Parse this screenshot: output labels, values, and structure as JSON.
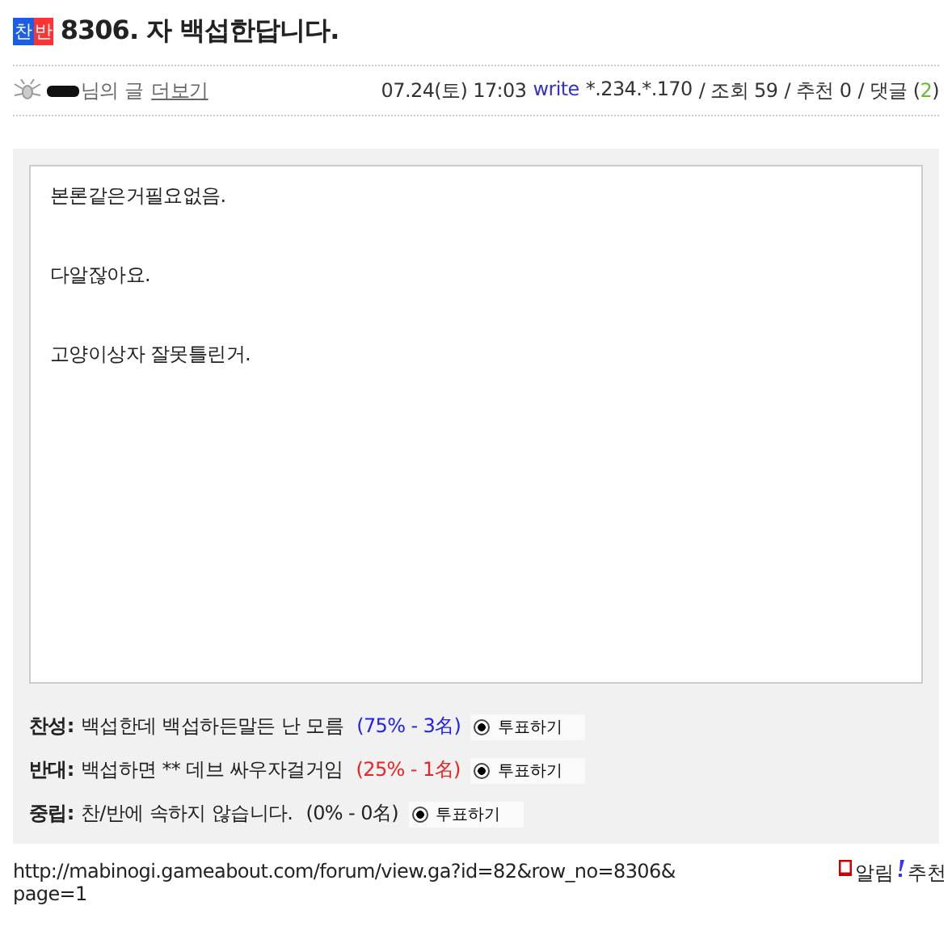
{
  "title": {
    "badge_left": "찬",
    "badge_right": "반",
    "text": "8306. 자 백섭한답니다."
  },
  "meta": {
    "suffix": "님의 글",
    "more_link": "더보기",
    "datetime": "07.24(토) 17:03",
    "write": "write",
    "ip": "*.234.*.170",
    "views": "/ 조회 59",
    "recommends": "/ 추천 0",
    "comments_label": "/ 댓글 (",
    "comments_count": "2",
    "comments_close": ")"
  },
  "body": {
    "paragraphs": [
      "본론같은거필요없음.",
      "다알잖아요.",
      "고양이상자 잘못틀린거."
    ]
  },
  "poll": [
    {
      "label": "찬성:",
      "text": "백섭한데 백섭하든말든 난 모름",
      "result": "(75% - 3名)",
      "color": "#2222ee",
      "button": "투표하기"
    },
    {
      "label": "반대:",
      "text": "백섭하면 ** 데브 싸우자걸거임",
      "result": "(25% - 1名)",
      "color": "#ee2222",
      "button": "투표하기"
    },
    {
      "label": "중립:",
      "text": "찬/반에 속하지 않습니다.",
      "result": "(0% - 0名)",
      "color": "#222222",
      "button": "투표하기"
    }
  ],
  "footer": {
    "url": "http://mabinogi.gameabout.com/forum/view.ga?id=82&row_no=8306& page=1",
    "alarm": "알림",
    "recommend": "추천"
  }
}
